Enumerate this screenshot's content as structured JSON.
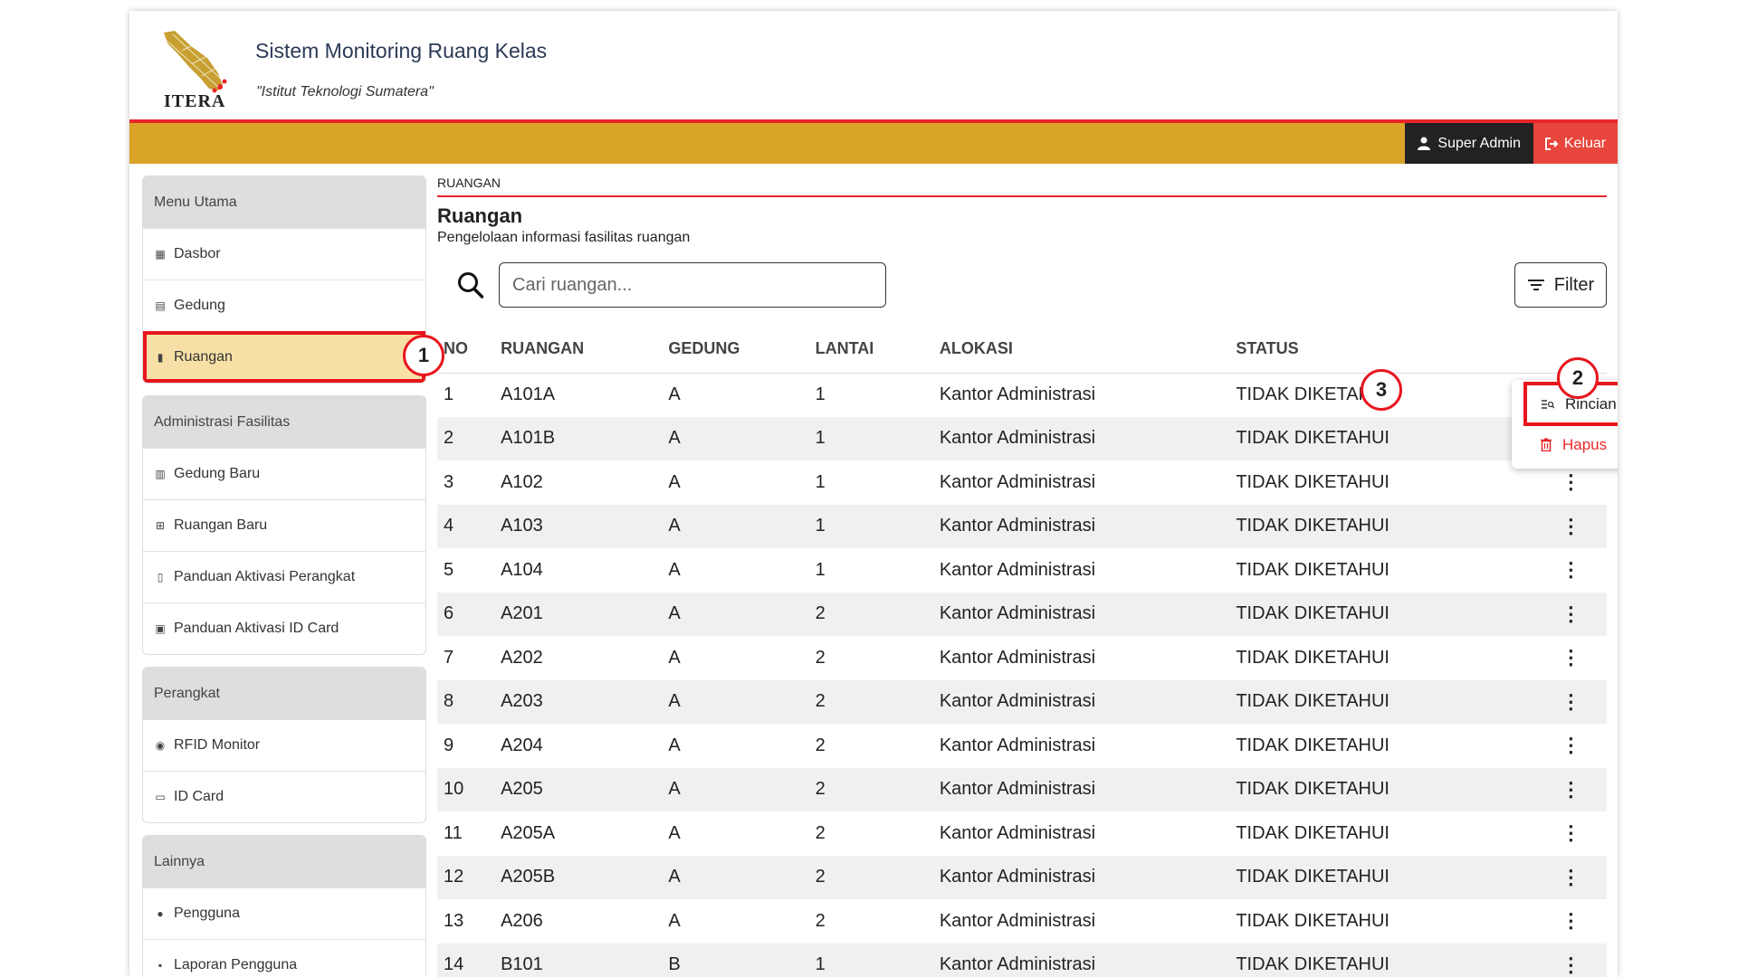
{
  "header": {
    "app_title": "Sistem Monitoring Ruang Kelas",
    "app_subtitle": "\"Istitut Teknologi Sumatera\"",
    "logo_text": "ITERA",
    "user_label": "Super Admin",
    "logout_label": "Keluar"
  },
  "sidebar": {
    "groups": [
      {
        "title": "Menu Utama",
        "items": [
          {
            "label": "Dasbor",
            "icon": "dashboard-icon"
          },
          {
            "label": "Gedung",
            "icon": "building-icon"
          },
          {
            "label": "Ruangan",
            "icon": "door-icon",
            "active": true
          }
        ]
      },
      {
        "title": "Administrasi Fasilitas",
        "items": [
          {
            "label": "Gedung Baru",
            "icon": "building-plus-icon"
          },
          {
            "label": "Ruangan Baru",
            "icon": "room-plus-icon"
          },
          {
            "label": "Panduan Aktivasi Perangkat",
            "icon": "document-icon"
          },
          {
            "label": "Panduan Aktivasi ID Card",
            "icon": "id-badge-icon"
          }
        ]
      },
      {
        "title": "Perangkat",
        "items": [
          {
            "label": "RFID Monitor",
            "icon": "rfid-icon"
          },
          {
            "label": "ID Card",
            "icon": "id-card-icon"
          }
        ]
      },
      {
        "title": "Lainnya",
        "items": [
          {
            "label": "Pengguna",
            "icon": "users-icon"
          },
          {
            "label": "Laporan Pengguna",
            "icon": "report-icon"
          }
        ]
      }
    ]
  },
  "main": {
    "breadcrumb": "RUANGAN",
    "title": "Ruangan",
    "description": "Pengelolaan informasi fasilitas ruangan",
    "search_placeholder": "Cari ruangan...",
    "filter_label": "Filter",
    "columns": [
      "NO",
      "RUANGAN",
      "GEDUNG",
      "LANTAI",
      "ALOKASI",
      "STATUS"
    ],
    "rows": [
      [
        "1",
        "A101A",
        "A",
        "1",
        "Kantor Administrasi",
        "TIDAK DIKETAHUI"
      ],
      [
        "2",
        "A101B",
        "A",
        "1",
        "Kantor Administrasi",
        "TIDAK DIKETAHUI"
      ],
      [
        "3",
        "A102",
        "A",
        "1",
        "Kantor Administrasi",
        "TIDAK DIKETAHUI"
      ],
      [
        "4",
        "A103",
        "A",
        "1",
        "Kantor Administrasi",
        "TIDAK DIKETAHUI"
      ],
      [
        "5",
        "A104",
        "A",
        "1",
        "Kantor Administrasi",
        "TIDAK DIKETAHUI"
      ],
      [
        "6",
        "A201",
        "A",
        "2",
        "Kantor Administrasi",
        "TIDAK DIKETAHUI"
      ],
      [
        "7",
        "A202",
        "A",
        "2",
        "Kantor Administrasi",
        "TIDAK DIKETAHUI"
      ],
      [
        "8",
        "A203",
        "A",
        "2",
        "Kantor Administrasi",
        "TIDAK DIKETAHUI"
      ],
      [
        "9",
        "A204",
        "A",
        "2",
        "Kantor Administrasi",
        "TIDAK DIKETAHUI"
      ],
      [
        "10",
        "A205",
        "A",
        "2",
        "Kantor Administrasi",
        "TIDAK DIKETAHUI"
      ],
      [
        "11",
        "A205A",
        "A",
        "2",
        "Kantor Administrasi",
        "TIDAK DIKETAHUI"
      ],
      [
        "12",
        "A205B",
        "A",
        "2",
        "Kantor Administrasi",
        "TIDAK DIKETAHUI"
      ],
      [
        "13",
        "A206",
        "A",
        "2",
        "Kantor Administrasi",
        "TIDAK DIKETAHUI"
      ],
      [
        "14",
        "B101",
        "B",
        "1",
        "Kantor Administrasi",
        "TIDAK DIKETAHUI"
      ]
    ],
    "action_menu": {
      "detail_label": "Rincian",
      "delete_label": "Hapus"
    }
  },
  "annotations": [
    "1",
    "2",
    "3"
  ],
  "colors": {
    "accent_red": "#e8262a",
    "topbar_gold": "#d9a427",
    "active_bg": "#f6e0a6",
    "logout_red": "#e8453c"
  }
}
